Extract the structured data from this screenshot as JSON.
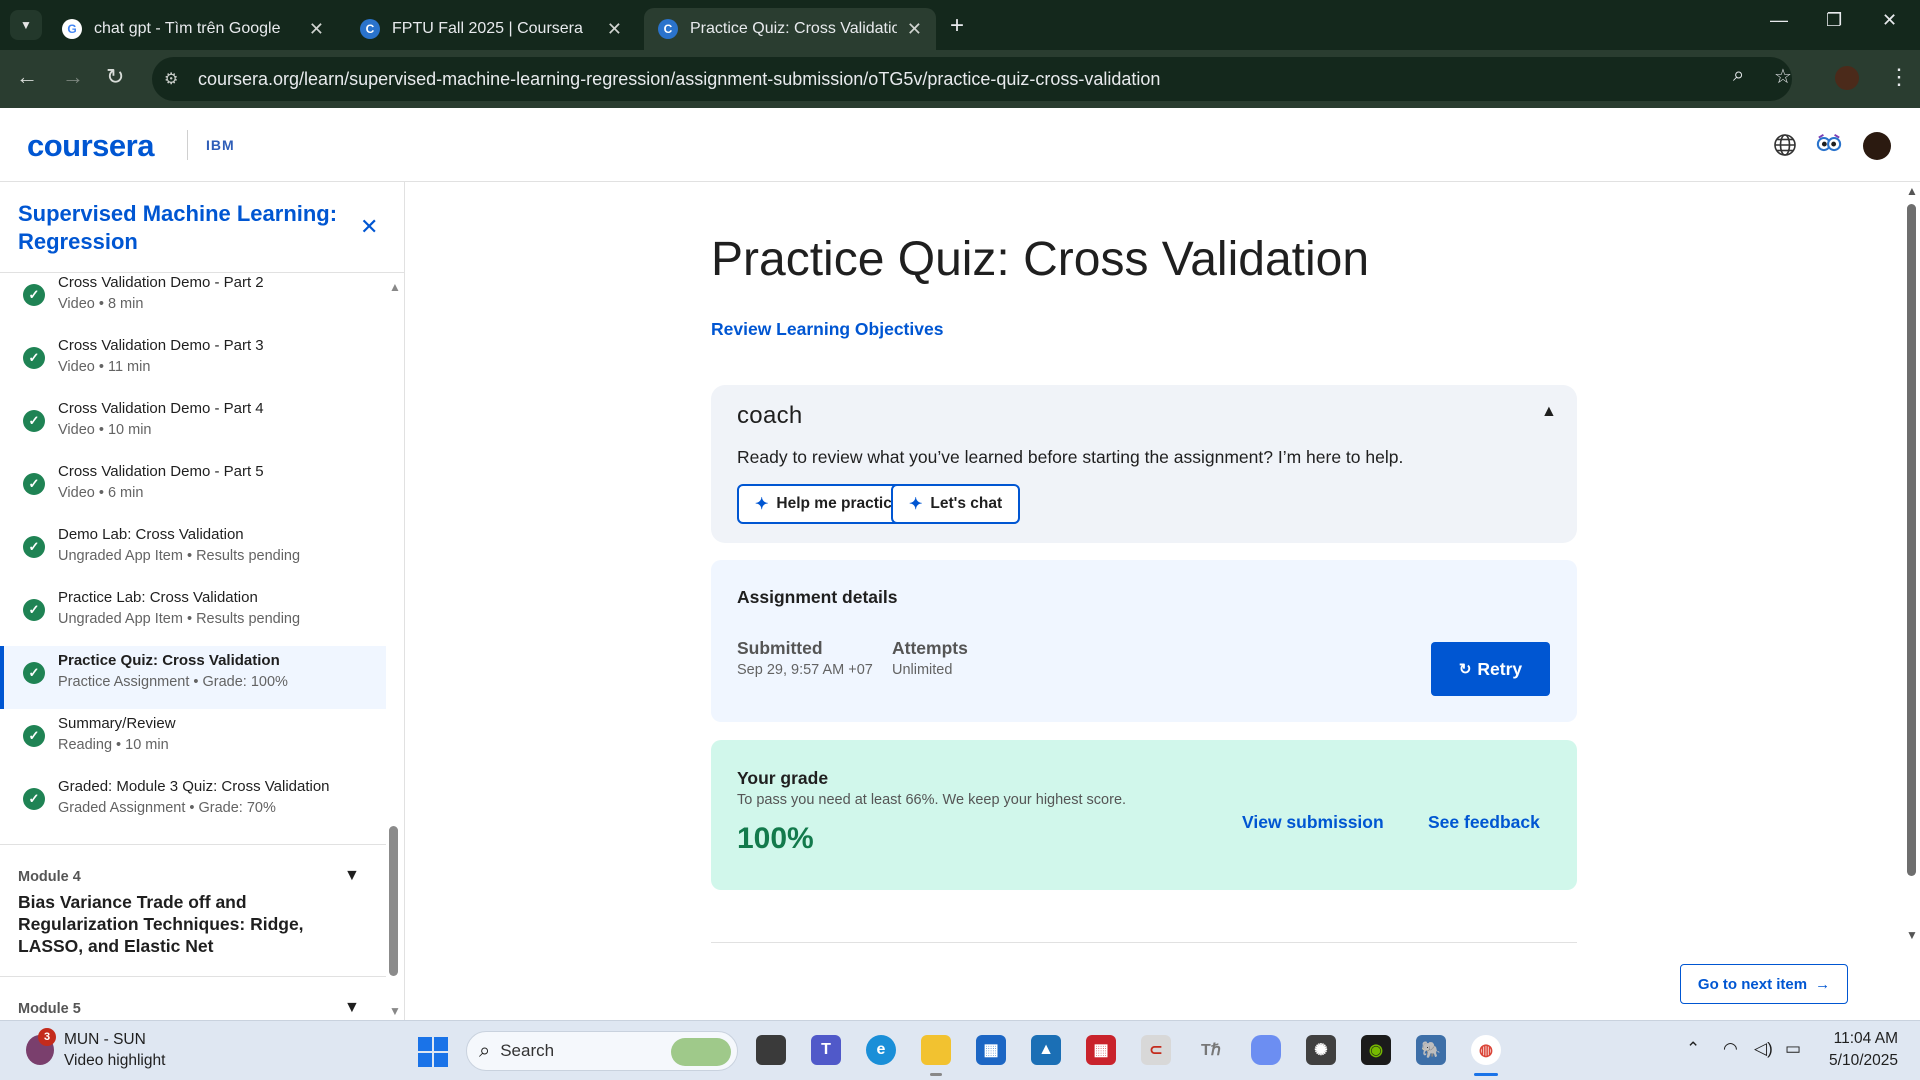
{
  "browser": {
    "tabs": [
      {
        "title": "chat gpt - Tìm trên Google",
        "favicon": "google-icon"
      },
      {
        "title": "FPTU Fall 2025 | Coursera",
        "favicon": "coursera-icon"
      },
      {
        "title": "Practice Quiz: Cross Validation |",
        "favicon": "coursera-icon"
      }
    ],
    "url": "coursera.org/learn/supervised-machine-learning-regression/assignment-submission/oTG5v/practice-quiz-cross-validation"
  },
  "header": {
    "logo": "coursera",
    "partner": "IBM"
  },
  "sidebar": {
    "course_title": "Supervised Machine Learning: Regression",
    "items": [
      {
        "name": "Cross Validation Demo - Part 2",
        "meta": "Video • 8 min"
      },
      {
        "name": "Cross Validation Demo - Part 3",
        "meta": "Video • 11 min"
      },
      {
        "name": "Cross Validation Demo - Part 4",
        "meta": "Video • 10 min"
      },
      {
        "name": "Cross Validation Demo - Part 5",
        "meta": "Video • 6 min"
      },
      {
        "name": "Demo Lab: Cross Validation",
        "meta": "Ungraded App Item • Results pending"
      },
      {
        "name": "Practice Lab: Cross Validation",
        "meta": "Ungraded App Item • Results pending"
      },
      {
        "name": "Practice Quiz: Cross Validation",
        "meta": "Practice Assignment • Grade: 100%"
      },
      {
        "name": "Summary/Review",
        "meta": "Reading • 10 min"
      },
      {
        "name": "Graded: Module 3 Quiz: Cross Validation",
        "meta": "Graded Assignment • Grade: 70%"
      }
    ],
    "modules": [
      {
        "number": "Module 4",
        "title": "Bias Variance Trade off and Regularization Techniques: Ridge, LASSO, and Elastic Net"
      },
      {
        "number": "Module 5",
        "title": ""
      }
    ]
  },
  "main": {
    "title": "Practice Quiz: Cross Validation",
    "review_link": "Review Learning Objectives",
    "coach": {
      "logo": "coach",
      "text": "Ready to review what you’ve learned before starting the assignment? I’m here to help.",
      "btn_practice": "Help me practice",
      "btn_chat": "Let's chat"
    },
    "assignment": {
      "heading": "Assignment details",
      "submitted_label": "Submitted",
      "submitted_value": "Sep 29, 9:57 AM +07",
      "attempts_label": "Attempts",
      "attempts_value": "Unlimited",
      "retry": "Retry"
    },
    "grade": {
      "label": "Your grade",
      "note": "To pass you need at least 66%. We keep your highest score.",
      "score": "100%",
      "view_submission": "View submission",
      "see_feedback": "See feedback"
    },
    "next_item": "Go to next item"
  },
  "taskbar": {
    "widget_badge": "3",
    "widget_line1": "MUN - SUN",
    "widget_line2": "Video highlight",
    "search": "Search",
    "time": "11:04 AM",
    "date": "5/10/2025"
  },
  "colors": {
    "brand": "#0056d2",
    "success": "#1f8354",
    "grade_bg": "#d1f7eb",
    "browser_frame": "#14281c"
  }
}
